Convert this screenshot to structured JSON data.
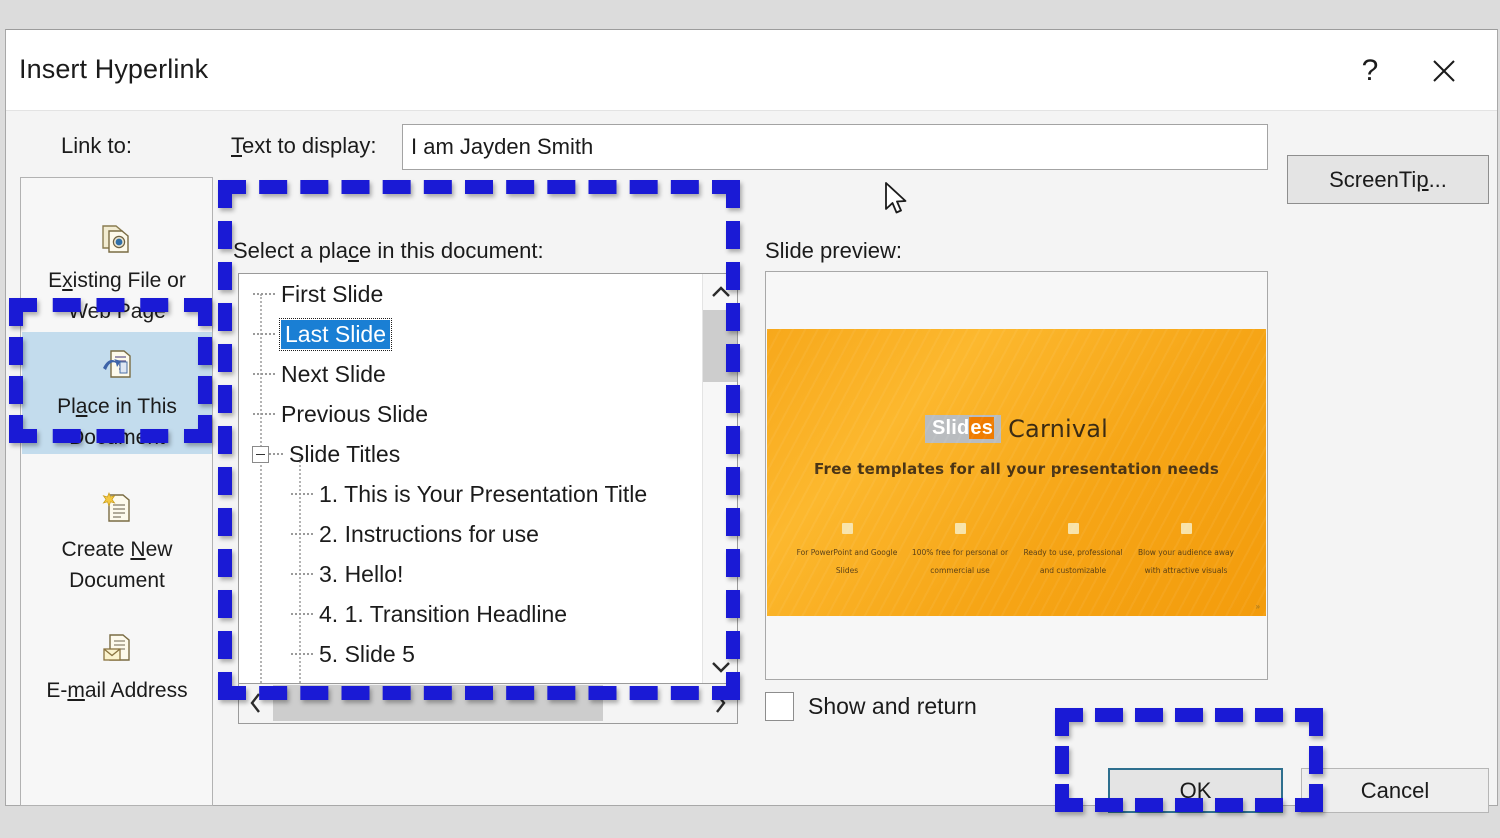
{
  "dialog": {
    "title": "Insert Hyperlink",
    "help_icon": "?",
    "close_icon": "close-icon"
  },
  "toolbar": {
    "link_to_label": "Link to:",
    "text_to_display_label_pre": "T",
    "text_to_display_label_post": "ext to display:",
    "text_to_display_value": "I am Jayden Smith",
    "text_to_display_placeholder": "",
    "screentip_label_pre": "ScreenTi",
    "screentip_label_accel": "p",
    "screentip_label_post": "..."
  },
  "sidebar": {
    "items": [
      {
        "id": "existing-file-or-web-page",
        "icon": "file-web-page-icon",
        "line1_pre": "E",
        "line1_accel": "x",
        "line1_post": "isting File or",
        "line2": "Web Page",
        "selected": false
      },
      {
        "id": "place-in-this-document",
        "icon": "place-in-document-icon",
        "line1_pre": "Pl",
        "line1_accel": "a",
        "line1_post": "ce in This",
        "line2": "Document",
        "selected": true
      },
      {
        "id": "create-new-document",
        "icon": "new-document-icon",
        "line1_pre": "Create ",
        "line1_accel": "N",
        "line1_post": "ew",
        "line2": "Document",
        "selected": false
      },
      {
        "id": "email-address",
        "icon": "email-address-icon",
        "line1_pre": "E-",
        "line1_accel": "m",
        "line1_post": "ail Address",
        "line2": "",
        "selected": false
      }
    ]
  },
  "center": {
    "label_pre": "Select a pla",
    "label_accel": "c",
    "label_post": "e in this document:",
    "tree": [
      {
        "label": "First Slide",
        "level": 1,
        "selected": false,
        "expander": false
      },
      {
        "label": "Last Slide",
        "level": 1,
        "selected": true,
        "expander": false
      },
      {
        "label": "Next Slide",
        "level": 1,
        "selected": false,
        "expander": false
      },
      {
        "label": "Previous Slide",
        "level": 1,
        "selected": false,
        "expander": false
      },
      {
        "label": "Slide Titles",
        "level": 1,
        "selected": false,
        "expander": true
      },
      {
        "label": "1. This is Your Presentation Title",
        "level": 2,
        "selected": false,
        "expander": false
      },
      {
        "label": "2. Instructions for use",
        "level": 2,
        "selected": false,
        "expander": false
      },
      {
        "label": "3. Hello!",
        "level": 2,
        "selected": false,
        "expander": false
      },
      {
        "label": "4. 1. Transition Headline",
        "level": 2,
        "selected": false,
        "expander": false
      },
      {
        "label": "5. Slide 5",
        "level": 2,
        "selected": false,
        "expander": false
      }
    ],
    "scroll_up_icon": "chevron-up-icon",
    "scroll_down_icon": "chevron-down-icon",
    "scroll_left_icon": "chevron-left-icon",
    "scroll_right_icon": "chevron-right-icon"
  },
  "preview": {
    "label": "Slide preview:",
    "slide": {
      "logo_pre": "Slid",
      "logo_accent": "es",
      "logo_word": "Carnival",
      "tagline": "Free templates for all your presentation needs",
      "features": [
        "For PowerPoint and Google Slides",
        "100% free for personal or commercial use",
        "Ready to use, professional and customizable",
        "Blow your audience away with attractive visuals"
      ],
      "corner_mark": "»"
    }
  },
  "options": {
    "show_and_return_label": "Show and return",
    "show_and_return_checked": false
  },
  "buttons": {
    "ok_label": "OK",
    "cancel_label": "Cancel"
  },
  "annotations": {
    "highlight_color": "#1a1ad5",
    "selection_color": "#1a7fd4",
    "sidebar_selected_bg": "#c3dced",
    "ok_focus_border": "#2e6f8e"
  },
  "cursor": {
    "icon": "mouse-pointer-icon"
  }
}
